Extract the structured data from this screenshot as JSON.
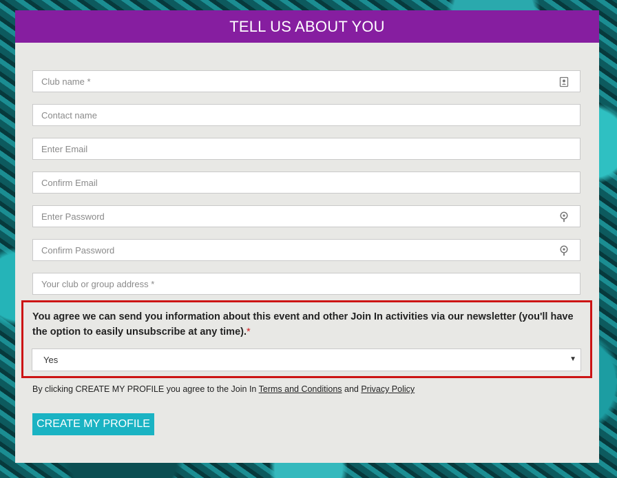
{
  "header": {
    "title": "TELL US ABOUT YOU"
  },
  "fields": {
    "club_name": {
      "placeholder": "Club name *",
      "value": "",
      "icon": "contact-card-icon"
    },
    "contact_name": {
      "placeholder": "Contact name",
      "value": ""
    },
    "email": {
      "placeholder": "Enter Email",
      "value": ""
    },
    "confirm_email": {
      "placeholder": "Confirm Email",
      "value": ""
    },
    "password": {
      "placeholder": "Enter Password",
      "value": "",
      "icon": "key-icon"
    },
    "confirm_password": {
      "placeholder": "Confirm Password",
      "value": "",
      "icon": "key-icon"
    },
    "address": {
      "placeholder": "Your club or group address *",
      "value": ""
    }
  },
  "consent": {
    "text": "You agree we can send you information about this event and other Join In activities via our newsletter (you'll have the option to easily unsubscribe at any time).",
    "required_mark": "*",
    "selected": "Yes",
    "caret": "▼"
  },
  "terms": {
    "prefix": "By clicking CREATE MY PROFILE you agree to the Join In ",
    "terms_link": "Terms and Conditions",
    "and": " and ",
    "privacy_link": "Privacy Policy"
  },
  "cta": {
    "label": "CREATE MY PROFILE"
  },
  "colors": {
    "header_bg": "#861ea0",
    "cta_bg": "#1ab3c3",
    "highlight_border": "#cc1414",
    "panel_bg": "#e8e8e5"
  }
}
